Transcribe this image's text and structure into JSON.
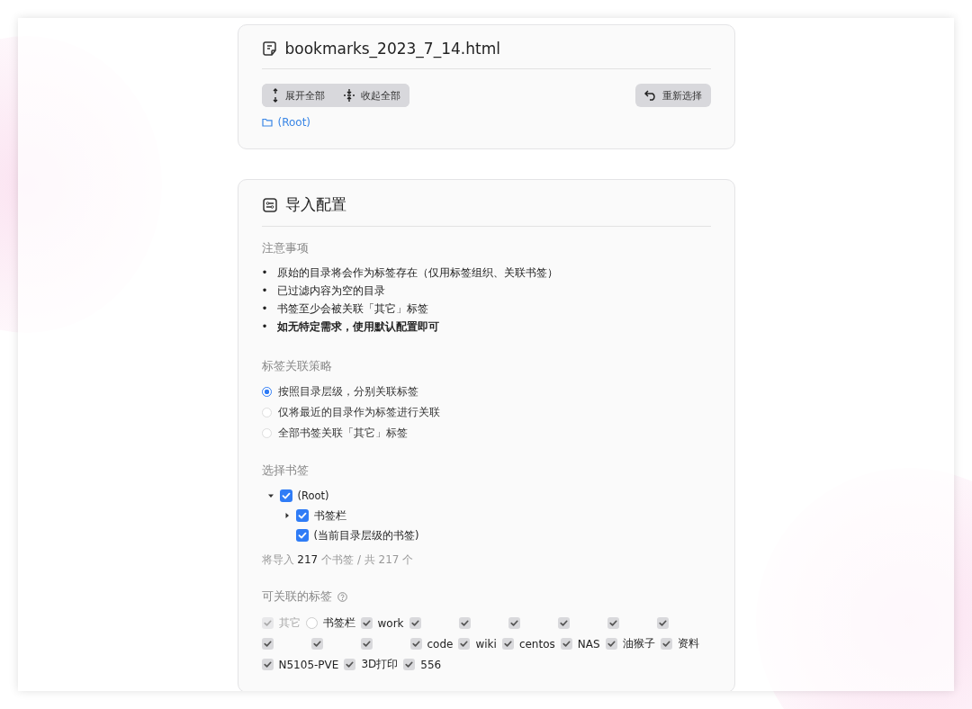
{
  "file_card": {
    "title": "bookmarks_2023_7_14.html",
    "expand_all": "展开全部",
    "collapse_all": "收起全部",
    "reselect": "重新选择",
    "path": "(Root)"
  },
  "config_card": {
    "title": "导入配置",
    "notes_heading": "注意事项",
    "notes": [
      {
        "marker": "•",
        "text": "原始的目录将会作为标签存在（仅用标签组织、关联书签）",
        "bold": false
      },
      {
        "marker": "•",
        "text": "已过滤内容为空的目录",
        "bold": false
      },
      {
        "marker": "•",
        "text": "书签至少会被关联「其它」标签",
        "bold": false
      },
      {
        "marker": "•",
        "text": "如无特定需求，使用默认配置即可",
        "bold": true
      }
    ],
    "strategy_heading": "标签关联策略",
    "strategies": [
      {
        "label": "按照目录层级，分别关联标签",
        "selected": true
      },
      {
        "label": "仅将最近的目录作为标签进行关联",
        "selected": false
      },
      {
        "label": "全部书签关联「其它」标签",
        "selected": false
      }
    ],
    "select_heading": "选择书签",
    "tree": [
      {
        "label": "(Root)",
        "checked": true,
        "expanded": true,
        "children": [
          {
            "label": "书签栏",
            "checked": true,
            "expanded": false
          },
          {
            "label": "(当前目录层级的书签)",
            "checked": true
          }
        ]
      }
    ],
    "summary": {
      "prefix": "将导入",
      "count": "217",
      "suffix": "个书签 / 共 217 个"
    },
    "tags_heading": "可关联的标签",
    "tags": [
      {
        "label": "其它",
        "checked": true,
        "disabled": true
      },
      {
        "label": "书签栏",
        "checked": false,
        "disabled": false
      },
      {
        "label": "work",
        "checked": true,
        "disabled": false
      },
      {
        "kind": "redacted",
        "checked": true,
        "disabled": false
      },
      {
        "kind": "redacted",
        "checked": true,
        "disabled": false
      },
      {
        "kind": "redacted",
        "checked": true,
        "disabled": false
      },
      {
        "kind": "redacted",
        "checked": true,
        "disabled": false
      },
      {
        "kind": "redacted",
        "checked": true,
        "disabled": false
      },
      {
        "kind": "redacted",
        "checked": true,
        "disabled": false
      },
      {
        "kind": "redacted",
        "checked": true,
        "disabled": false
      },
      {
        "kind": "redacted",
        "checked": true,
        "disabled": false
      },
      {
        "kind": "redacted",
        "checked": true,
        "disabled": false
      },
      {
        "label": "code",
        "checked": true,
        "disabled": false
      },
      {
        "label": "wiki",
        "checked": true,
        "disabled": false
      },
      {
        "label": "centos",
        "checked": true,
        "disabled": false
      },
      {
        "label": "NAS",
        "checked": true,
        "disabled": false
      },
      {
        "label": "油猴子",
        "checked": true,
        "disabled": false
      },
      {
        "label": "资料",
        "checked": true,
        "disabled": false
      },
      {
        "label": "N5105-PVE",
        "checked": true,
        "disabled": false
      },
      {
        "label": "3D打印",
        "checked": true,
        "disabled": false
      },
      {
        "label": "556",
        "checked": true,
        "disabled": false
      }
    ]
  }
}
